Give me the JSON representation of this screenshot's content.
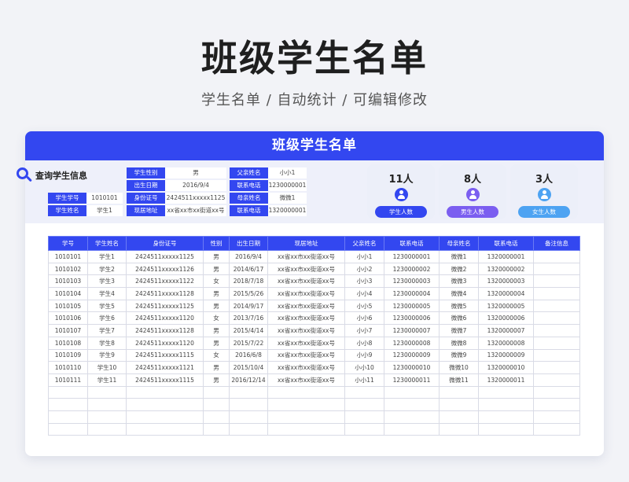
{
  "hero": {
    "title": "班级学生名单",
    "subtitle": "学生名单 / 自动统计 / 可编辑修改"
  },
  "card": {
    "title": "班级学生名单",
    "accent_color": "#3347f0"
  },
  "query": {
    "label": "查询学生信息",
    "fields": [
      {
        "label": "学生学号",
        "value": "1010101"
      },
      {
        "label": "学生姓名",
        "value": "学生1"
      },
      {
        "label": "学生性别",
        "value": "男"
      },
      {
        "label": "出生日期",
        "value": "2016/9/4"
      },
      {
        "label": "身份证号",
        "value": "2424511xxxxx1125"
      },
      {
        "label": "现居地址",
        "value": "xx省xx市xx街道xx号"
      },
      {
        "label": "父亲姓名",
        "value": "小小1"
      },
      {
        "label": "联系电话",
        "value": "1230000001"
      },
      {
        "label": "母亲姓名",
        "value": "微微1"
      },
      {
        "label": "联系电话",
        "value": "1320000001"
      }
    ]
  },
  "stats": [
    {
      "count": "11人",
      "label": "学生人数",
      "icon": "users-icon",
      "color": "#3347f0"
    },
    {
      "count": "8人",
      "label": "男生人数",
      "icon": "users-icon",
      "color": "#7b5ef0"
    },
    {
      "count": "3人",
      "label": "女生人数",
      "icon": "users-icon",
      "color": "#4da3f2"
    }
  ],
  "table": {
    "headers": [
      "学号",
      "学生姓名",
      "身份证号",
      "性别",
      "出生日期",
      "现居地址",
      "父亲姓名",
      "联系电话",
      "母亲姓名",
      "联系电话",
      "备注信息"
    ],
    "rows": [
      [
        "1010101",
        "学生1",
        "2424511xxxxx1125",
        "男",
        "2016/9/4",
        "xx省xx市xx街道xx号",
        "小小1",
        "1230000001",
        "微微1",
        "1320000001",
        ""
      ],
      [
        "1010102",
        "学生2",
        "2424511xxxxx1126",
        "男",
        "2014/6/17",
        "xx省xx市xx街道xx号",
        "小小2",
        "1230000002",
        "微微2",
        "1320000002",
        ""
      ],
      [
        "1010103",
        "学生3",
        "2424511xxxxx1122",
        "女",
        "2018/7/18",
        "xx省xx市xx街道xx号",
        "小小3",
        "1230000003",
        "微微3",
        "1320000003",
        ""
      ],
      [
        "1010104",
        "学生4",
        "2424511xxxxx1128",
        "男",
        "2015/5/26",
        "xx省xx市xx街道xx号",
        "小小4",
        "1230000004",
        "微微4",
        "1320000004",
        ""
      ],
      [
        "1010105",
        "学生5",
        "2424511xxxxx1125",
        "男",
        "2014/9/17",
        "xx省xx市xx街道xx号",
        "小小5",
        "1230000005",
        "微微5",
        "1320000005",
        ""
      ],
      [
        "1010106",
        "学生6",
        "2424511xxxxx1120",
        "女",
        "2013/7/16",
        "xx省xx市xx街道xx号",
        "小小6",
        "1230000006",
        "微微6",
        "1320000006",
        ""
      ],
      [
        "1010107",
        "学生7",
        "2424511xxxxx1128",
        "男",
        "2015/4/14",
        "xx省xx市xx街道xx号",
        "小小7",
        "1230000007",
        "微微7",
        "1320000007",
        ""
      ],
      [
        "1010108",
        "学生8",
        "2424511xxxxx1120",
        "男",
        "2015/7/22",
        "xx省xx市xx街道xx号",
        "小小8",
        "1230000008",
        "微微8",
        "1320000008",
        ""
      ],
      [
        "1010109",
        "学生9",
        "2424511xxxxx1115",
        "女",
        "2016/6/8",
        "xx省xx市xx街道xx号",
        "小小9",
        "1230000009",
        "微微9",
        "1320000009",
        ""
      ],
      [
        "1010110",
        "学生10",
        "2424511xxxxx1121",
        "男",
        "2015/10/4",
        "xx省xx市xx街道xx号",
        "小小10",
        "1230000010",
        "微微10",
        "1320000010",
        ""
      ],
      [
        "1010111",
        "学生11",
        "2424511xxxxx1115",
        "男",
        "2016/12/14",
        "xx省xx市xx街道xx号",
        "小小11",
        "1230000011",
        "微微11",
        "1320000011",
        ""
      ]
    ],
    "empty_rows": 4
  }
}
